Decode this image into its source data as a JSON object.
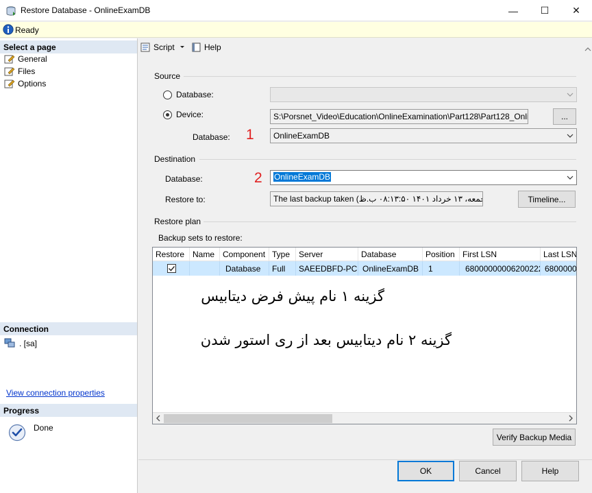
{
  "window": {
    "title": "Restore Database - OnlineExamDB",
    "minimize_glyph": "—",
    "maximize_glyph": "☐",
    "close_glyph": "✕"
  },
  "status": {
    "text": "Ready",
    "icon": "info-icon"
  },
  "left_pane": {
    "select_page_header": "Select a page",
    "pages": [
      {
        "label": "General"
      },
      {
        "label": "Files"
      },
      {
        "label": "Options"
      }
    ],
    "connection_header": "Connection",
    "connection_text": ". [sa]",
    "view_connection_link": "View connection properties",
    "progress_header": "Progress",
    "progress_text": "Done"
  },
  "toolbar": {
    "script_label": "Script",
    "help_label": "Help"
  },
  "source": {
    "section_label": "Source",
    "database_radio_label": "Database:",
    "device_radio_label": "Device:",
    "device_path": "S:\\Porsnet_Video\\Education\\OnlineExamination\\Part128\\Part128_Onlir",
    "browse_label": "...",
    "database_label": "Database:",
    "database_value": "OnlineExamDB",
    "marker": "1"
  },
  "destination": {
    "section_label": "Destination",
    "database_label": "Database:",
    "database_value": "OnlineExamDB",
    "marker": "2",
    "restore_to_label": "Restore to:",
    "restore_to_value": "The last backup taken (جمعه، ۱۳ خرداد ۱۴۰۱ ۰۸:۱۳:۵۰ ب.ظ)",
    "timeline_label": "Timeline..."
  },
  "restore_plan": {
    "section_label": "Restore plan",
    "backup_sets_label": "Backup sets to restore:",
    "columns": [
      "Restore",
      "Name",
      "Component",
      "Type",
      "Server",
      "Database",
      "Position",
      "First LSN",
      "Last LSN"
    ],
    "row": {
      "name": "",
      "component": "Database",
      "type": "Full",
      "server": "SAEEDBFD-PC",
      "database": "OnlineExamDB",
      "position": "1",
      "first_lsn": "68000000006200222",
      "last_lsn": "68000000"
    },
    "annotation_1": "گزینه ۱ نام پیش فرض دیتابیس",
    "annotation_2": "گزینه ۲ نام دیتابیس بعد از ری استور شدن",
    "verify_label": "Verify Backup Media"
  },
  "buttons": {
    "ok": "OK",
    "cancel": "Cancel",
    "help": "Help"
  },
  "colors": {
    "selection": "#cce8ff",
    "accent": "#0078d7",
    "marker": "#e02020",
    "status_bg": "#ffffe1"
  }
}
